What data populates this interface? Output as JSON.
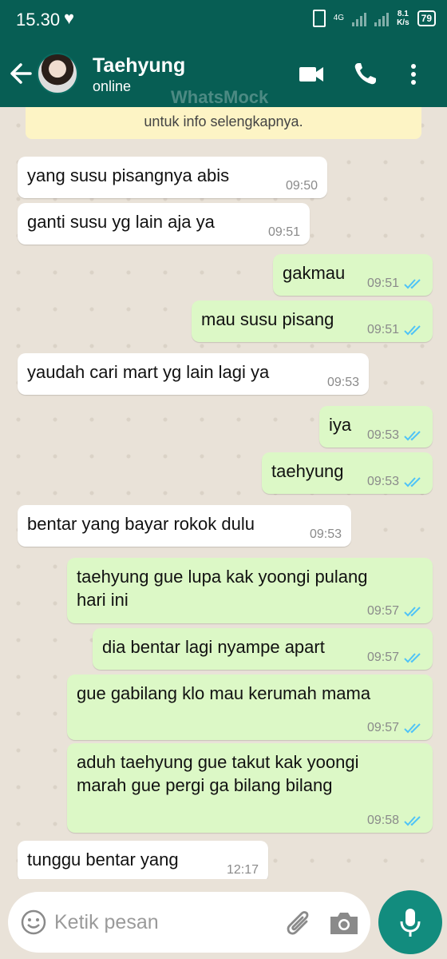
{
  "statusbar": {
    "time": "15.30",
    "network": "4G",
    "speed_value": "8.1",
    "speed_unit": "K/s",
    "battery": "79"
  },
  "header": {
    "contact_name": "Taehyung",
    "contact_status": "online",
    "watermark": "WhatsMock"
  },
  "notice": {
    "text": "untuk info selengkapnya."
  },
  "messages": [
    {
      "dir": "in",
      "lines": [
        "yang susu pisangnya abis"
      ],
      "time": "09:50"
    },
    {
      "dir": "in",
      "lines": [
        "ganti susu yg lain aja ya"
      ],
      "time": "09:51"
    },
    {
      "dir": "out",
      "lines": [
        "gakmau"
      ],
      "time": "09:51",
      "read": true
    },
    {
      "dir": "out",
      "lines": [
        "mau susu pisang"
      ],
      "time": "09:51",
      "read": true
    },
    {
      "dir": "in",
      "lines": [
        "yaudah cari mart yg lain lagi ya"
      ],
      "time": "09:53"
    },
    {
      "dir": "out",
      "lines": [
        "iya"
      ],
      "time": "09:53",
      "read": true
    },
    {
      "dir": "out",
      "lines": [
        "taehyung"
      ],
      "time": "09:53",
      "read": true
    },
    {
      "dir": "in",
      "lines": [
        "bentar yang bayar rokok dulu"
      ],
      "time": "09:53"
    },
    {
      "dir": "out",
      "lines": [
        "taehyung gue lupa kak yoongi pulang",
        "hari ini"
      ],
      "time": "09:57",
      "read": true
    },
    {
      "dir": "out",
      "lines": [
        "dia bentar lagi nyampe apart"
      ],
      "time": "09:57",
      "read": true
    },
    {
      "dir": "out",
      "lines": [
        "gue gabilang klo mau kerumah mama"
      ],
      "time": "09:57",
      "read": true
    },
    {
      "dir": "out",
      "lines": [
        "aduh taehyung gue takut kak yoongi",
        "marah gue pergi ga bilang bilang"
      ],
      "time": "09:58",
      "read": true
    },
    {
      "dir": "in",
      "lines": [
        "tunggu bentar yang"
      ],
      "time": "12:17"
    }
  ],
  "input": {
    "placeholder": "Ketik pesan"
  },
  "colors": {
    "header": "#075e54",
    "outgoing": "#dcf8c6",
    "incoming": "#ffffff",
    "read_ticks": "#4fc3f7",
    "mic_button": "#128c7e"
  },
  "icons": {
    "back": "arrow-left-icon",
    "video": "video-call-icon",
    "call": "phone-icon",
    "menu": "more-vert-icon",
    "emoji": "emoji-icon",
    "attach": "paperclip-icon",
    "camera": "camera-icon",
    "mic": "mic-icon"
  }
}
